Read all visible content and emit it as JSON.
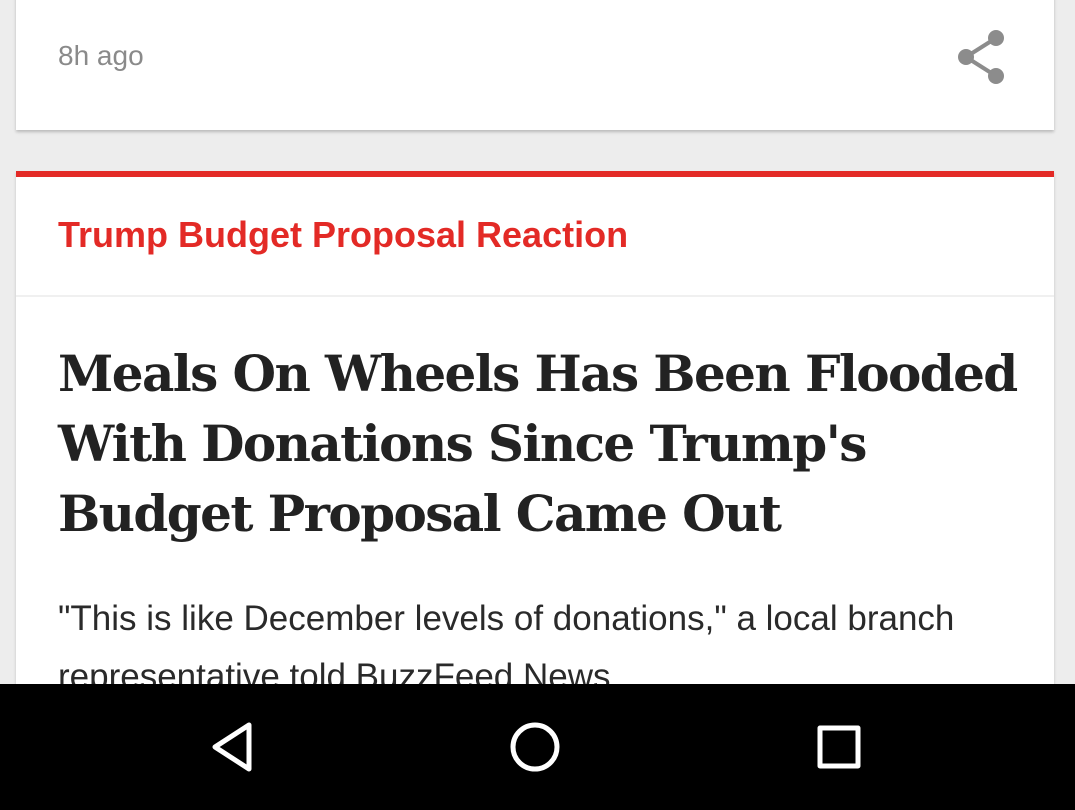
{
  "feed": {
    "previous_card": {
      "timestamp": "8h ago",
      "share_icon": "share-icon"
    },
    "story_card": {
      "accent_color": "#e32a26",
      "topic": "Trump Budget Proposal Reaction",
      "headline": "Meals On Wheels Has Been Flooded With Donations Since Trump's Budget Proposal Came Out",
      "dek": "\"This is like December levels of donations,\" a local branch representative told BuzzFeed News."
    }
  },
  "navigation_bar": {
    "back_icon": "back-triangle-icon",
    "home_icon": "home-circle-icon",
    "recents_icon": "recents-square-icon"
  }
}
